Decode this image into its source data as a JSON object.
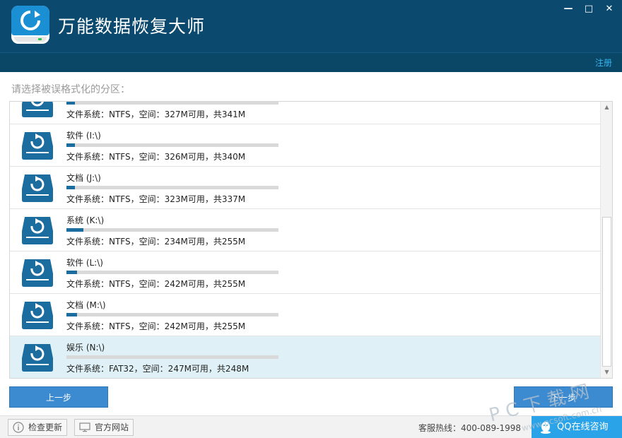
{
  "window": {
    "title": "万能数据恢复大师",
    "minimize_label": "—",
    "maximize_label": "□",
    "close_label": "✕",
    "register_label": "注册"
  },
  "prompt": "请选择被误格式化的分区：",
  "drives": [
    {
      "name": "",
      "info": "文件系统：NTFS，空间：327M可用，共341M",
      "used_fraction": 0.04,
      "selected": false
    },
    {
      "name": "软件 (I:\\)",
      "info": "文件系统：NTFS，空间：326M可用，共340M",
      "used_fraction": 0.04,
      "selected": false
    },
    {
      "name": "文档 (J:\\)",
      "info": "文件系统：NTFS，空间：323M可用，共337M",
      "used_fraction": 0.04,
      "selected": false
    },
    {
      "name": "系统 (K:\\)",
      "info": "文件系统：NTFS，空间：234M可用，共255M",
      "used_fraction": 0.08,
      "selected": false
    },
    {
      "name": "软件 (L:\\)",
      "info": "文件系统：NTFS，空间：242M可用，共255M",
      "used_fraction": 0.05,
      "selected": false
    },
    {
      "name": "文档 (M:\\)",
      "info": "文件系统：NTFS，空间：242M可用，共255M",
      "used_fraction": 0.05,
      "selected": false
    },
    {
      "name": "娱乐 (N:\\)",
      "info": "文件系统：FAT32，空间：247M可用，共248M",
      "used_fraction": 0.0,
      "selected": true
    }
  ],
  "buttons": {
    "prev_label": "上一步",
    "next_label": "下一步"
  },
  "footer": {
    "check_update_label": "检查更新",
    "official_site_label": "官方网站",
    "hotline": "客服热线：400-089-1998",
    "qq_label": "QQ在线咨询"
  },
  "watermark": {
    "line1": "P C 下 载 网",
    "line2": "www.pcsoft.com.cn"
  },
  "colors": {
    "header": "#0b4a6e",
    "accent": "#3c8bd0",
    "selected_row": "#dff1f6",
    "usage_bar": "#1a6d9e",
    "drive_icon": "#1a6d9e"
  }
}
